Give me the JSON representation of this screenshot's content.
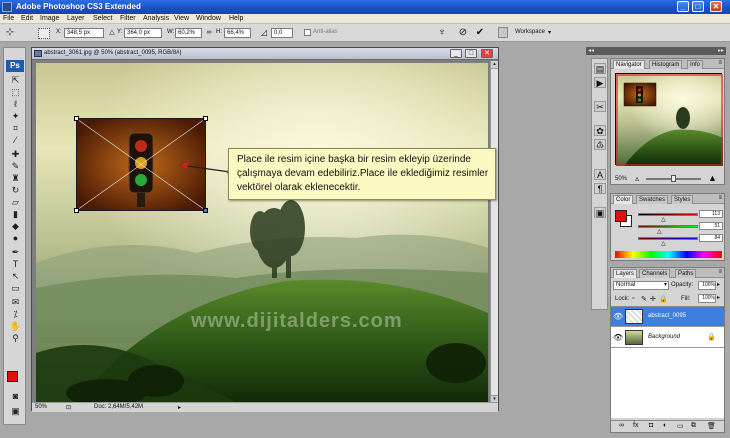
{
  "app": {
    "title": "Adobe Photoshop CS3 Extended"
  },
  "menu": [
    "File",
    "Edit",
    "Image",
    "Layer",
    "Select",
    "Filter",
    "Analysis",
    "View",
    "Window",
    "Help"
  ],
  "options": {
    "x_label": "X:",
    "x_value": "348,5 px",
    "y_label": "Y:",
    "y_value": "364,0 px",
    "w_label": "W:",
    "w_value": "60,2%",
    "h_label": "H:",
    "h_value": "66,4%",
    "angle_value": "0,0",
    "antialias_label": "Anti-alias",
    "workspace_label": "Workspace"
  },
  "document": {
    "title": "abstract_3061.jpg @ 50% (abstract_0095, RGB/8#)",
    "zoom": "50%",
    "doc_info": "Doc: 2,64M/5,42M"
  },
  "callout": {
    "text": "Place ile resim içine başka bir resim ekleyip üzerinde çalışmaya devam edebiliriz.Place ile eklediğimiz resimler vektörel olarak eklenecektir."
  },
  "watermark": "www.dijitalders.com",
  "navigator": {
    "tabs": [
      "Navigator",
      "Histogram",
      "Info"
    ],
    "zoom": "50%"
  },
  "color_panel": {
    "tabs": [
      "Color",
      "Swatches",
      "Styles"
    ],
    "values": [
      "113",
      "51",
      "84"
    ]
  },
  "layers_panel": {
    "tabs": [
      "Layers",
      "Channels",
      "Paths"
    ],
    "blend_mode": "Normal",
    "opacity_label": "Opacity:",
    "opacity_value": "100%",
    "lock_label": "Lock:",
    "fill_label": "Fill:",
    "fill_value": "100%",
    "layers": [
      {
        "name": "abstract_0095",
        "selected": true
      },
      {
        "name": "Background",
        "selected": false
      }
    ]
  },
  "colors": {
    "foreground": "#e01010",
    "background": "#ffffff",
    "selected_layer": "#3d7ee0",
    "titlebar": "#1a4fc2"
  }
}
